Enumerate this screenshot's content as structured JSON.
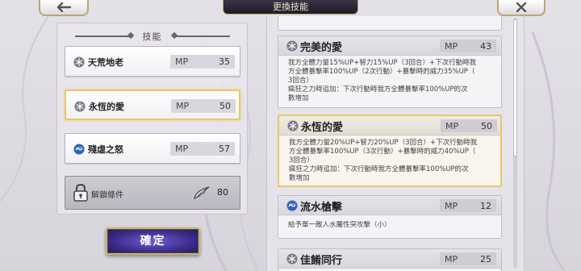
{
  "header": {
    "title": "更換技能",
    "back_icon": "arrow-left-icon",
    "close_icon": "close-icon"
  },
  "left_panel": {
    "title": "技能",
    "slots": [
      {
        "name": "天荒地老",
        "mp_label": "MP",
        "mp": "35",
        "icon": "snowflake-icon"
      },
      {
        "name": "永恆的愛",
        "mp_label": "MP",
        "mp": "50",
        "icon": "snowflake-icon",
        "selected": true
      },
      {
        "name": "殘虐之怒",
        "mp_label": "MP",
        "mp": "57",
        "icon": "water-icon"
      }
    ],
    "unlock": {
      "label": "解鎖條件",
      "value": "80",
      "icon": "lock-icon",
      "wing_icon": "wing-icon"
    }
  },
  "confirm_label": "確定",
  "skill_list": [
    {
      "name": "完美的愛",
      "mp_label": "MP",
      "mp": "43",
      "icon": "snowflake-icon",
      "lines": [
        "我方全體力量15%UP+智力15%UP（3回合）+下次行動時我",
        "方全體暴擊率100%UP（2次行動）+暴擊時的威力35%UP（",
        "3回合）",
        "瘋狂之力時追加：下次行動時我方全體暴擊率100%UP的次",
        "數增加"
      ]
    },
    {
      "name": "永恆的愛",
      "mp_label": "MP",
      "mp": "50",
      "icon": "snowflake-icon",
      "selected": true,
      "lines": [
        "我方全體力量20%UP+智力20%UP（3回合）+下次行動時我",
        "方全體暴擊率100%UP（3次行動）+暴擊時的威力40%UP（",
        "3回合）",
        "瘋狂之力時追加：下次行動時我方全體暴擊率100%UP的次",
        "數增加"
      ]
    },
    {
      "name": "流水槍擊",
      "mp_label": "MP",
      "mp": "12",
      "icon": "water-icon",
      "lines": [
        "給予單一敵人水屬性突攻擊（小）"
      ]
    },
    {
      "name": "佳餚同行",
      "mp_label": "MP",
      "mp": "25",
      "icon": "snowflake-icon",
      "lines": []
    }
  ]
}
